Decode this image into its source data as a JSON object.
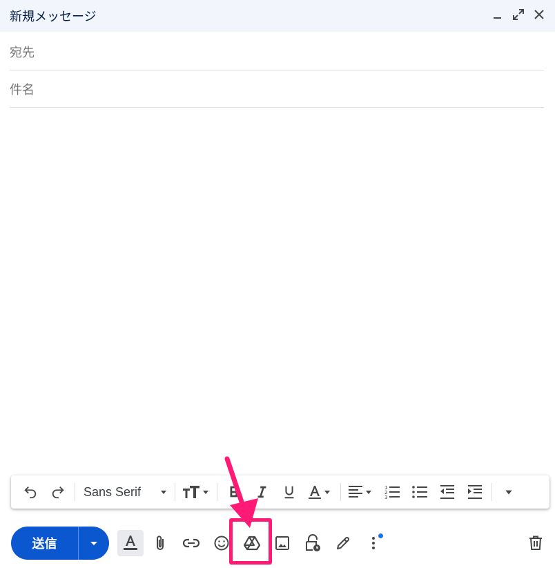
{
  "compose": {
    "title": "新規メッセージ",
    "to_placeholder": "宛先",
    "subject_placeholder": "件名",
    "body_text": ""
  },
  "window_controls": [
    "minimize-icon",
    "fullscreen-icon",
    "close-icon"
  ],
  "format_bar": {
    "font_name": "Sans Serif",
    "tools": [
      "undo-icon",
      "redo-icon",
      "font-select",
      "text-size-icon",
      "bold-icon",
      "italic-icon",
      "underline-icon",
      "text-color-icon",
      "align-icon",
      "numbered-list-icon",
      "bulleted-list-icon",
      "indent-less-icon",
      "indent-more-icon",
      "more-formatting-icon"
    ]
  },
  "bottom_bar": {
    "send_label": "送信",
    "tools": [
      "formatting-options-icon",
      "attach-icon",
      "link-icon",
      "emoji-icon",
      "google-drive-icon",
      "photo-icon",
      "confidential-mode-icon",
      "signature-icon",
      "more-options-icon",
      "discard-icon"
    ]
  },
  "annotation": {
    "highlight_color": "#ff1a75",
    "target": "google-drive-icon"
  },
  "colors": {
    "header_bg": "#f2f6fc",
    "send_button": "#0b57d0",
    "notification_dot": "#1a73e8"
  }
}
